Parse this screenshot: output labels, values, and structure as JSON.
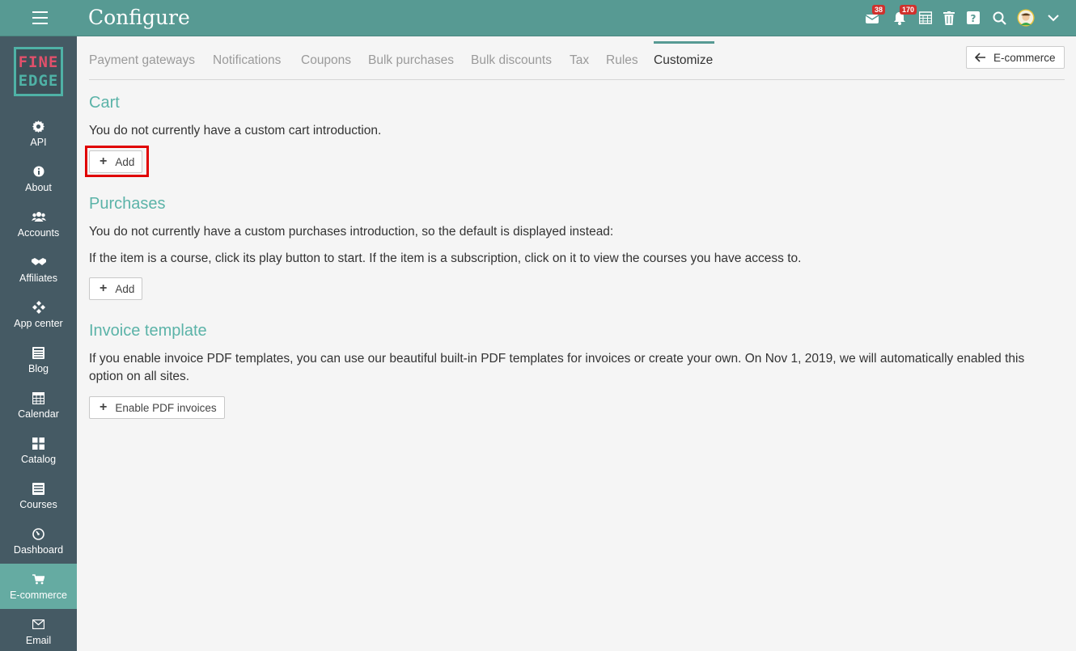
{
  "header": {
    "title": "Configure",
    "badges": {
      "messages": "38",
      "notifications": "170"
    },
    "icons": [
      "menu-icon",
      "envelope-icon",
      "bell-icon",
      "calendar-grid-icon",
      "trash-icon",
      "help-icon",
      "search-icon",
      "avatar",
      "chevron-down-icon"
    ]
  },
  "logo": {
    "line1": "FINE",
    "line2": "EDGE"
  },
  "sidebar": {
    "items": [
      {
        "label": "API",
        "icon": "gear-icon"
      },
      {
        "label": "About",
        "icon": "info-icon"
      },
      {
        "label": "Accounts",
        "icon": "users-icon"
      },
      {
        "label": "Affiliates",
        "icon": "handshake-icon"
      },
      {
        "label": "App center",
        "icon": "diamonds-icon"
      },
      {
        "label": "Blog",
        "icon": "newspaper-icon"
      },
      {
        "label": "Calendar",
        "icon": "calendar-icon"
      },
      {
        "label": "Catalog",
        "icon": "grid-icon"
      },
      {
        "label": "Courses",
        "icon": "list-icon"
      },
      {
        "label": "Dashboard",
        "icon": "gauge-icon"
      },
      {
        "label": "E-commerce",
        "icon": "cart-icon"
      },
      {
        "label": "Email",
        "icon": "mail-icon"
      }
    ],
    "active": "E-commerce"
  },
  "tabs": {
    "items": [
      "Payment gateways",
      "Notifications",
      "Coupons",
      "Bulk purchases",
      "Bulk discounts",
      "Tax",
      "Rules",
      "Customize"
    ],
    "active": "Customize",
    "back_label": "E-commerce"
  },
  "cart": {
    "title": "Cart",
    "text": "You do not currently have a custom cart introduction.",
    "button": "Add"
  },
  "purchases": {
    "title": "Purchases",
    "text1": "You do not currently have a custom purchases introduction, so the default is displayed instead:",
    "text2": "If the item is a course, click its play button to start. If the item is a subscription, click on it to view the courses you have access to.",
    "button": "Add"
  },
  "invoice": {
    "title": "Invoice template",
    "text": "If you enable invoice PDF templates, you can use our beautiful built-in PDF templates for invoices or create your own. On Nov 1, 2019, we will automatically enabled this option on all sites.",
    "button": "Enable PDF invoices"
  },
  "colors": {
    "topbar": "#579a93",
    "sidebar": "#455a64",
    "accent": "#5bb3a8",
    "active_sidebar": "#65aba2",
    "badge": "#d0312d",
    "highlight": "#e00000"
  }
}
